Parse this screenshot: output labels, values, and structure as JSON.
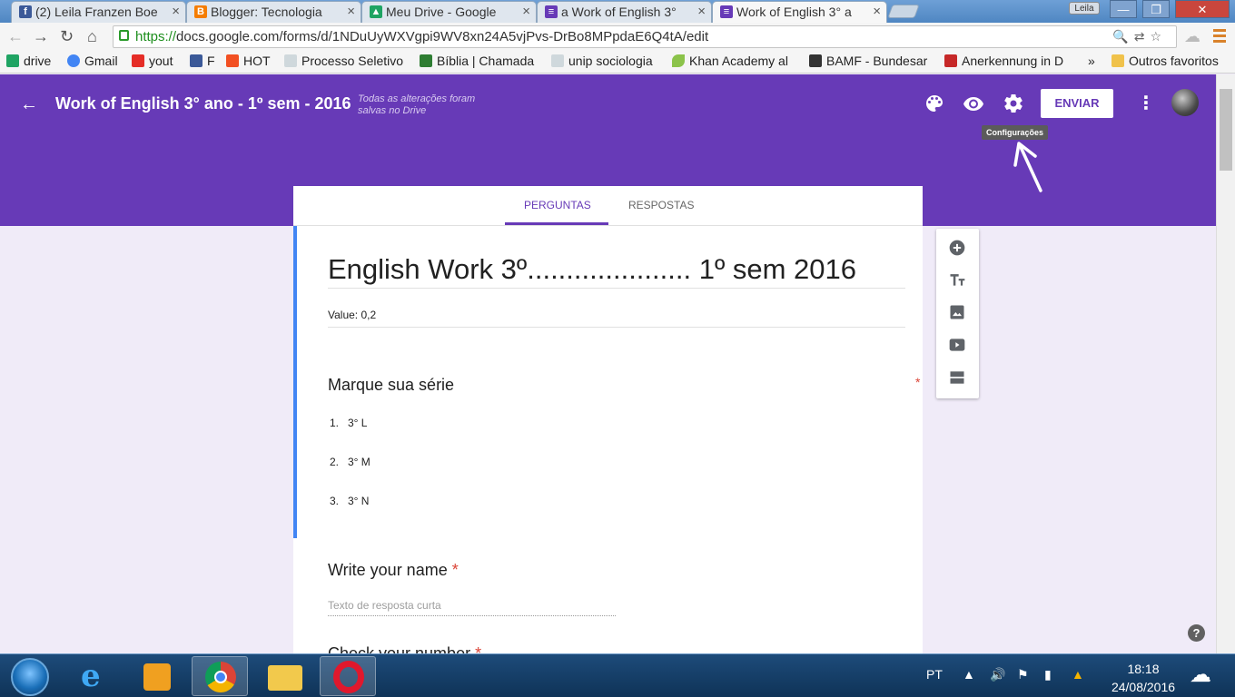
{
  "browser": {
    "tabs": [
      {
        "title": "(2) Leila Franzen Boe",
        "icon": "facebook-icon",
        "color": "#3b5998"
      },
      {
        "title": "Blogger: Tecnologia",
        "icon": "blogger-icon",
        "color": "#f57d00"
      },
      {
        "title": "Meu Drive - Google",
        "icon": "drive-icon",
        "color": "#1fa463"
      },
      {
        "title": "a Work of English 3°",
        "icon": "forms-icon",
        "color": "#673ab7"
      },
      {
        "title": "Work of English 3° a",
        "icon": "forms-icon",
        "color": "#673ab7",
        "active": true
      }
    ],
    "user_badge": "Leila",
    "url_scheme": "https://",
    "url_rest": "docs.google.com/forms/d/1NDuUyWXVgpi9WV8xn24A5vjPvs-DrBo8MPpdaE6Q4tA/edit",
    "bookmarks": [
      {
        "label": "drive",
        "icon": "drive-icon",
        "color": "#1fa463"
      },
      {
        "label": "Gmail",
        "icon": "google-icon",
        "color": "#4285f4"
      },
      {
        "label": "yout",
        "icon": "youtube-icon",
        "color": "#e52d27"
      },
      {
        "label": "F",
        "icon": "facebook-icon",
        "color": "#3b5998"
      },
      {
        "label": "HOT",
        "icon": "hotmail-icon",
        "color": "#f25022"
      },
      {
        "label": "Processo Seletivo",
        "icon": "page-icon",
        "color": "#b0bec5"
      },
      {
        "label": "Bíblia | Chamada",
        "icon": "bible-icon",
        "color": "#2e7d32"
      },
      {
        "label": "unip sociologia",
        "icon": "page-icon",
        "color": "#b0bec5"
      },
      {
        "label": "Khan Academy al",
        "icon": "leaf-icon",
        "color": "#8bc34a"
      },
      {
        "label": "BAMF - Bundesar",
        "icon": "eagle-icon",
        "color": "#333333"
      },
      {
        "label": "Anerkennung in D",
        "icon": "grid-icon",
        "color": "#c62828"
      },
      {
        "label": "Outros favoritos",
        "icon": "folder-icon",
        "color": "#f0c24b"
      }
    ],
    "bookmarks_overflow": "»"
  },
  "forms": {
    "header_title": "Work of English 3° ano - 1º sem -  2016",
    "saved_status": "Todas as alterações foram salvas no Drive",
    "send_label": "ENVIAR",
    "settings_tooltip": "Configurações",
    "tab_questions": "PERGUNTAS",
    "tab_responses": "RESPOSTAS",
    "doc_title": "English Work 3º..................... 1º sem 2016",
    "description": "Value: 0,2",
    "questions": [
      {
        "title": "Marque sua série",
        "required_mark": "*",
        "options": [
          {
            "num": "1.",
            "label": "3° L"
          },
          {
            "num": "2.",
            "label": "3° M"
          },
          {
            "num": "3.",
            "label": "3° N"
          }
        ]
      },
      {
        "title": "Write your name",
        "required_mark": "*",
        "placeholder": "Texto de resposta curta"
      },
      {
        "title": "Check your number",
        "required_mark": "*"
      }
    ],
    "accent_color": "#673ab7"
  },
  "taskbar": {
    "language": "PT",
    "time": "18:18",
    "date": "24/08/2016"
  }
}
